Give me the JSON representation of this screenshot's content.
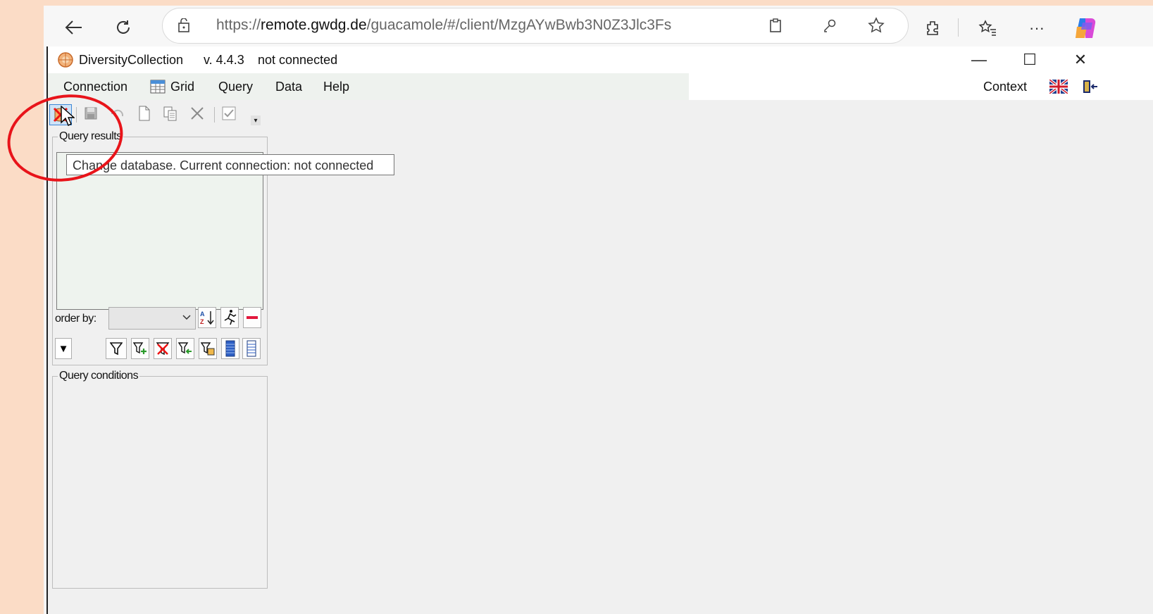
{
  "browser": {
    "url_prefix": "https://",
    "url_domain": "remote.gwdg.de",
    "url_path": "/guacamole/#/client/MzgAYwBwb3N0Z3Jlc3Fs",
    "more_label": "···",
    "icons": [
      "back-icon",
      "refresh-icon",
      "site-info-icon",
      "reader-mode-icon",
      "password-icon",
      "favorite-star-icon",
      "extensions-icon",
      "favorites-icon",
      "more-icon",
      "copilot-icon"
    ]
  },
  "app": {
    "name": "DiversityCollection",
    "version": "v. 4.4.3",
    "status": "not connected",
    "window_controls": {
      "minimize": "—",
      "maximize": "☐",
      "close": "✕"
    }
  },
  "menu": {
    "connection": "Connection",
    "grid": "Grid",
    "query": "Query",
    "data": "Data",
    "help": "Help",
    "context": "Context"
  },
  "query_panel": {
    "results_title": "Query results",
    "order_by_label": "order by:",
    "order_by_value": "",
    "conditions_title": "Query conditions",
    "collapse_arrow": "▼"
  },
  "tooltip": {
    "text": "Change database. Current connection: not connected"
  },
  "colors": {
    "page_bg": "#fbdcc6",
    "annotation_circle": "#e8141a",
    "listbox_bg": "#eef3ee"
  }
}
